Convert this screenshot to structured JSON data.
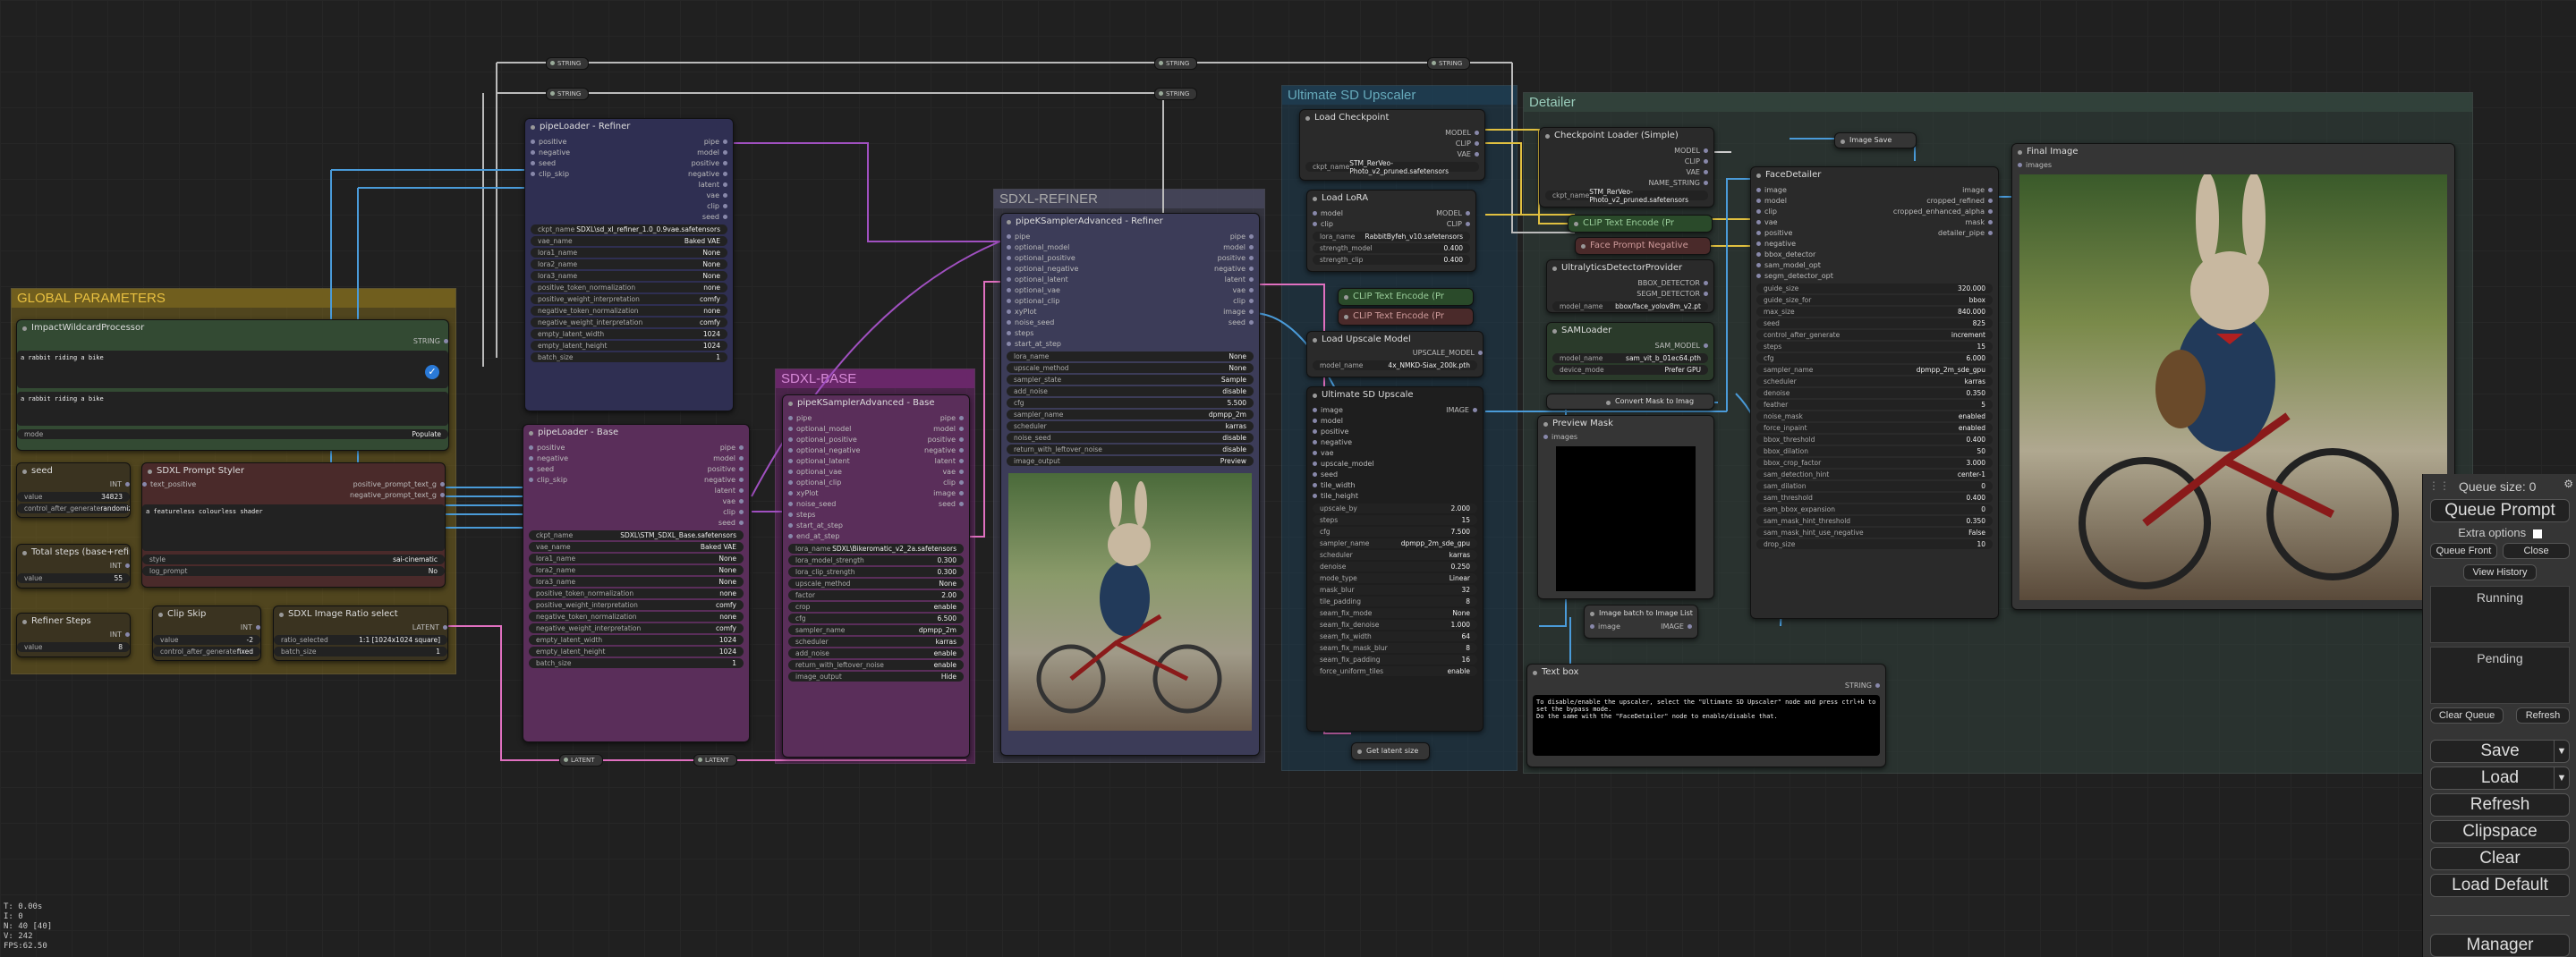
{
  "groups": {
    "global": "GLOBAL PARAMETERS",
    "sdxl_base": "SDXL-BASE",
    "sdxl_refiner": "SDXL-REFINER",
    "usd": "Ultimate SD Upscaler",
    "detailer": "Detailer"
  },
  "reroutes": {
    "string": "STRING",
    "latent": "LATENT"
  },
  "wildcard": {
    "title": "ImpactWildcardProcessor",
    "out": "STRING",
    "text1": "a rabbit riding a bike",
    "text2": "a rabbit riding a bike",
    "mode_label": "mode",
    "mode_value": "Populate"
  },
  "seed": {
    "title": "seed",
    "out": "INT",
    "value_label": "value",
    "value": "34823",
    "control_label": "control_after_generate",
    "control": "randomize"
  },
  "styler": {
    "title": "SDXL Prompt Styler",
    "in1": "text_positive",
    "out1": "positive_prompt_text_g",
    "out2": "negative_prompt_text_g",
    "text": "a featureless colourless shader",
    "style_label": "style",
    "style": "sai-cinematic",
    "log_label": "log_prompt",
    "log": "No"
  },
  "steps": {
    "title": "Total steps (base+refiner)",
    "out": "INT",
    "value_label": "value",
    "value": "55"
  },
  "refsteps": {
    "title": "Refiner Steps",
    "out": "INT",
    "value_label": "value",
    "value": "8"
  },
  "clipskip": {
    "title": "Clip Skip",
    "out": "INT",
    "value_label": "value",
    "value": "-2",
    "control_label": "control_after_generate",
    "control": "fixed"
  },
  "ratio": {
    "title": "SDXL Image Ratio select",
    "out": "LATENT",
    "w1": "ratio_selected",
    "v1": "1:1 [1024x1024 square]",
    "w2": "batch_size",
    "v2": "1"
  },
  "pl_refiner": {
    "title": "pipeLoader - Refiner",
    "inputs": [
      "positive",
      "negative",
      "seed",
      "clip_skip"
    ],
    "outputs": [
      "pipe",
      "model",
      "positive",
      "negative",
      "latent",
      "vae",
      "clip",
      "seed"
    ],
    "widgets": [
      [
        "ckpt_name",
        "SDXL\\sd_xl_refiner_1.0_0.9vae.safetensors"
      ],
      [
        "vae_name",
        "Baked VAE"
      ],
      [
        "lora1_name",
        "None"
      ],
      [
        "lora2_name",
        "None"
      ],
      [
        "lora3_name",
        "None"
      ],
      [
        "positive_token_normalization",
        "none"
      ],
      [
        "positive_weight_interpretation",
        "comfy"
      ],
      [
        "negative_token_normalization",
        "none"
      ],
      [
        "negative_weight_interpretation",
        "comfy"
      ],
      [
        "empty_latent_width",
        "1024"
      ],
      [
        "empty_latent_height",
        "1024"
      ],
      [
        "batch_size",
        "1"
      ]
    ]
  },
  "pl_base": {
    "title": "pipeLoader - Base",
    "inputs": [
      "positive",
      "negative",
      "seed",
      "clip_skip"
    ],
    "outputs": [
      "pipe",
      "model",
      "positive",
      "negative",
      "latent",
      "vae",
      "clip",
      "seed"
    ],
    "widgets": [
      [
        "ckpt_name",
        "SDXL\\STM_SDXL_Base.safetensors"
      ],
      [
        "vae_name",
        "Baked VAE"
      ],
      [
        "lora1_name",
        "None"
      ],
      [
        "lora2_name",
        "None"
      ],
      [
        "lora3_name",
        "None"
      ],
      [
        "positive_token_normalization",
        "none"
      ],
      [
        "positive_weight_interpretation",
        "comfy"
      ],
      [
        "negative_token_normalization",
        "none"
      ],
      [
        "negative_weight_interpretation",
        "comfy"
      ],
      [
        "empty_latent_width",
        "1024"
      ],
      [
        "empty_latent_height",
        "1024"
      ],
      [
        "batch_size",
        "1"
      ]
    ]
  },
  "ks_base": {
    "title": "pipeKSamplerAdvanced - Base",
    "inputs": [
      "pipe",
      "optional_model",
      "optional_positive",
      "optional_negative",
      "optional_latent",
      "optional_vae",
      "optional_clip",
      "xyPlot",
      "noise_seed",
      "steps",
      "start_at_step",
      "end_at_step"
    ],
    "outputs": [
      "pipe",
      "model",
      "positive",
      "negative",
      "latent",
      "vae",
      "clip",
      "image",
      "seed"
    ],
    "widgets": [
      [
        "lora_name",
        "SDXL\\Bikeromatic_v2_2a.safetensors"
      ],
      [
        "lora_model_strength",
        "0.300"
      ],
      [
        "lora_clip_strength",
        "0.300"
      ],
      [
        "upscale_method",
        "None"
      ],
      [
        "factor",
        "2.00"
      ],
      [
        "crop",
        "enable"
      ],
      [
        "cfg",
        "6.500"
      ],
      [
        "sampler_name",
        "dpmpp_2m"
      ],
      [
        "scheduler",
        "karras"
      ],
      [
        "add_noise",
        "enable"
      ],
      [
        "return_with_leftover_noise",
        "enable"
      ],
      [
        "image_output",
        "Hide"
      ]
    ]
  },
  "ks_ref": {
    "title": "pipeKSamplerAdvanced - Refiner",
    "inputs": [
      "pipe",
      "optional_model",
      "optional_positive",
      "optional_negative",
      "optional_latent",
      "optional_vae",
      "optional_clip",
      "xyPlot",
      "noise_seed",
      "steps",
      "start_at_step"
    ],
    "outputs": [
      "pipe",
      "model",
      "positive",
      "negative",
      "latent",
      "vae",
      "clip",
      "image",
      "seed"
    ],
    "widgets": [
      [
        "lora_name",
        "None"
      ],
      [
        "upscale_method",
        "None"
      ],
      [
        "sampler_state",
        "Sample"
      ],
      [
        "add_noise",
        "disable"
      ],
      [
        "cfg",
        "5.500"
      ],
      [
        "sampler_name",
        "dpmpp_2m"
      ],
      [
        "scheduler",
        "karras"
      ],
      [
        "noise_seed",
        "disable"
      ],
      [
        "return_with_leftover_noise",
        "disable"
      ],
      [
        "image_output",
        "Preview"
      ]
    ]
  },
  "ckpt": {
    "title": "Load Checkpoint",
    "outputs": [
      "MODEL",
      "CLIP",
      "VAE"
    ],
    "w": "ckpt_name",
    "v": "STM_RerVeo-Photo_v2_pruned.safetensors"
  },
  "lora": {
    "title": "Load LoRA",
    "inputs": [
      "model",
      "clip"
    ],
    "outputs": [
      "MODEL",
      "CLIP"
    ],
    "widgets": [
      [
        "lora_name",
        "RabbitByfeh_v10.safetensors"
      ],
      [
        "strength_model",
        "0.400"
      ],
      [
        "strength_clip",
        "0.400"
      ]
    ]
  },
  "clip_pos": "CLIP Text Encode (Pr",
  "clip_neg": "CLIP Text Encode (Pr",
  "upmodel": {
    "title": "Load Upscale Model",
    "out": "UPSCALE_MODEL",
    "w": "model_name",
    "v": "4x_NMKD-Siax_200k.pth"
  },
  "usd_node": {
    "title": "Ultimate SD Upscale",
    "inputs": [
      "image",
      "model",
      "positive",
      "negative",
      "vae",
      "upscale_model",
      "seed",
      "tile_width",
      "tile_height"
    ],
    "out": "IMAGE",
    "widgets": [
      [
        "upscale_by",
        "2.000"
      ],
      [
        "steps",
        "15"
      ],
      [
        "cfg",
        "7.500"
      ],
      [
        "sampler_name",
        "dpmpp_2m_sde_gpu"
      ],
      [
        "scheduler",
        "karras"
      ],
      [
        "denoise",
        "0.250"
      ],
      [
        "mode_type",
        "Linear"
      ],
      [
        "mask_blur",
        "32"
      ],
      [
        "tile_padding",
        "8"
      ],
      [
        "seam_fix_mode",
        "None"
      ],
      [
        "seam_fix_denoise",
        "1.000"
      ],
      [
        "seam_fix_width",
        "64"
      ],
      [
        "seam_fix_mask_blur",
        "8"
      ],
      [
        "seam_fix_padding",
        "16"
      ],
      [
        "force_uniform_tiles",
        "enable"
      ]
    ]
  },
  "get_latent": "Get latent size",
  "ckpt_simple": {
    "title": "Checkpoint Loader (Simple)",
    "outputs": [
      "MODEL",
      "CLIP",
      "VAE",
      "NAME_STRING"
    ],
    "w": "ckpt_name",
    "v": "STM_RerVeo-Photo_v2_pruned.safetensors"
  },
  "image_save": "Image Save",
  "clip_det": "CLIP Text Encode (Pr",
  "face_neg": "Face Prompt Negative",
  "ultra": {
    "title": "UltralyticsDetectorProvider",
    "outputs": [
      "BBOX_DETECTOR",
      "SEGM_DETECTOR"
    ],
    "w": "model_name",
    "v": "bbox/face_yolov8m_v2.pt"
  },
  "sam": {
    "title": "SAMLoader",
    "out": "SAM_MODEL",
    "widgets": [
      [
        "model_name",
        "sam_vit_b_01ec64.pth"
      ],
      [
        "device_mode",
        "Prefer GPU"
      ]
    ]
  },
  "mask2img": "Convert Mask to Imag",
  "preview_mask": {
    "title": "Preview Mask",
    "in": "images"
  },
  "batch2list": {
    "title": "Image batch to Image List",
    "in": "image",
    "out": "IMAGE"
  },
  "textbox": {
    "title": "Text box",
    "out": "STRING",
    "text": "To disable/enable the upscaler, select the \"Ultimate SD Upscaler\" node and press ctrl+b to set the bypass mode.\nDo the same with the \"FaceDetailer\" node to enable/disable that."
  },
  "facedetailer": {
    "title": "FaceDetailer",
    "inputs": [
      "image",
      "model",
      "clip",
      "vae",
      "positive",
      "negative",
      "bbox_detector",
      "sam_model_opt",
      "segm_detector_opt"
    ],
    "outputs": [
      "image",
      "cropped_refined",
      "cropped_enhanced_alpha",
      "mask",
      "detailer_pipe"
    ],
    "widgets": [
      [
        "guide_size",
        "320.000"
      ],
      [
        "guide_size_for",
        "bbox"
      ],
      [
        "max_size",
        "840.000"
      ],
      [
        "seed",
        "825"
      ],
      [
        "control_after_generate",
        "increment"
      ],
      [
        "steps",
        "15"
      ],
      [
        "cfg",
        "6.000"
      ],
      [
        "sampler_name",
        "dpmpp_2m_sde_gpu"
      ],
      [
        "scheduler",
        "karras"
      ],
      [
        "denoise",
        "0.350"
      ],
      [
        "feather",
        "5"
      ],
      [
        "noise_mask",
        "enabled"
      ],
      [
        "force_inpaint",
        "enabled"
      ],
      [
        "bbox_threshold",
        "0.400"
      ],
      [
        "bbox_dilation",
        "50"
      ],
      [
        "bbox_crop_factor",
        "3.000"
      ],
      [
        "sam_detection_hint",
        "center-1"
      ],
      [
        "sam_dilation",
        "0"
      ],
      [
        "sam_threshold",
        "0.400"
      ],
      [
        "sam_bbox_expansion",
        "0"
      ],
      [
        "sam_mask_hint_threshold",
        "0.350"
      ],
      [
        "sam_mask_hint_use_negative",
        "False"
      ],
      [
        "drop_size",
        "10"
      ]
    ]
  },
  "final_image": {
    "title": "Final Image",
    "in": "images"
  },
  "menu": {
    "queue_size": "Queue size: 0",
    "queue_prompt": "Queue Prompt",
    "extra_options": "Extra options",
    "queue_front": "Queue Front",
    "close": "Close",
    "view_history": "View History",
    "running": "Running",
    "pending": "Pending",
    "clear_queue": "Clear Queue",
    "refresh_small": "Refresh",
    "save": "Save",
    "load": "Load",
    "refresh": "Refresh",
    "clipspace": "Clipspace",
    "clear": "Clear",
    "load_default": "Load Default",
    "manager": "Manager"
  },
  "stats": [
    "T: 0.00s",
    "I: 0",
    "N: 40 [40]",
    "V: 242",
    "FPS:62.50"
  ],
  "colors": {
    "bg": "#202020",
    "global": "#6b5a1e",
    "base": "#6a2a6a",
    "refiner": "#3a3a52",
    "usd": "#1e3a4a",
    "detailer": "#2f3f3a",
    "link_blue": "#4a9bd9",
    "link_pink": "#e070c0",
    "link_yellow": "#e0c040",
    "link_white": "#cccccc",
    "link_purple": "#a050c0"
  }
}
